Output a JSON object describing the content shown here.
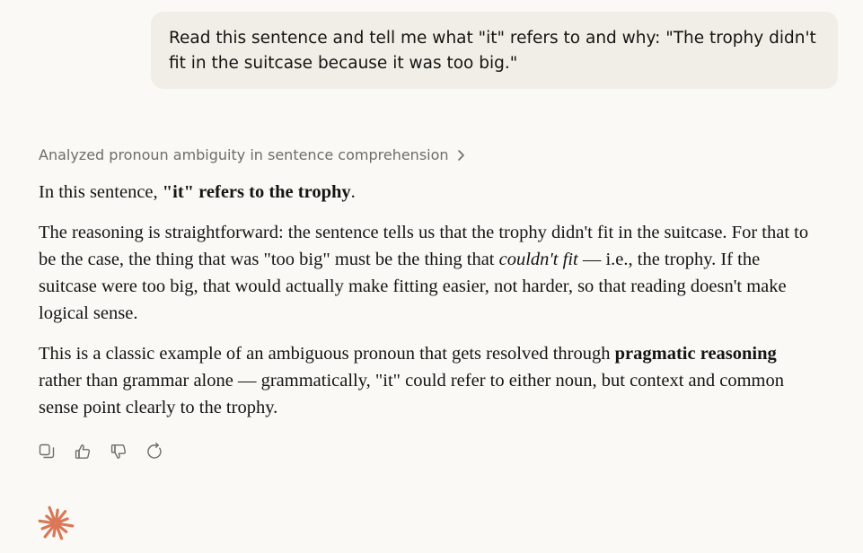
{
  "user_message": {
    "text": "Read this sentence and tell me what \"it\" refers to and why: \"The trophy didn't fit in the suitcase because it was too big.\""
  },
  "thinking_summary": {
    "label": "Analyzed pronoun ambiguity in sentence comprehension",
    "icon": "chevron-right-icon"
  },
  "response": {
    "p1": {
      "a": "In this sentence, ",
      "b": "\"it\" refers to the trophy",
      "c": "."
    },
    "p2": {
      "a": "The reasoning is straightforward: the sentence tells us that the trophy didn't fit in the suitcase. For that to be the case, the thing that was \"too big\" must be the thing that ",
      "b": "couldn't fit",
      "c": " — i.e., the trophy. If the suitcase were too big, that would actually make fitting easier, not harder, so that reading doesn't make logical sense."
    },
    "p3": {
      "a": "This is a classic example of an ambiguous pronoun that gets resolved through ",
      "b": "pragmatic reasoning",
      "c": " rather than grammar alone — grammatically, \"it\" could refer to either noun, but context and common sense point clearly to the trophy."
    }
  },
  "actions": [
    {
      "icon": "copy-icon"
    },
    {
      "icon": "thumbs-up-icon"
    },
    {
      "icon": "thumbs-down-icon"
    },
    {
      "icon": "retry-icon"
    }
  ],
  "brand": {
    "logo_icon": "claude-spark-icon",
    "accent_color": "#d97757"
  },
  "colors": {
    "background": "#faf9f5",
    "user_bubble": "#f0eee6",
    "text": "#141413",
    "muted_text": "#6e6d68"
  }
}
